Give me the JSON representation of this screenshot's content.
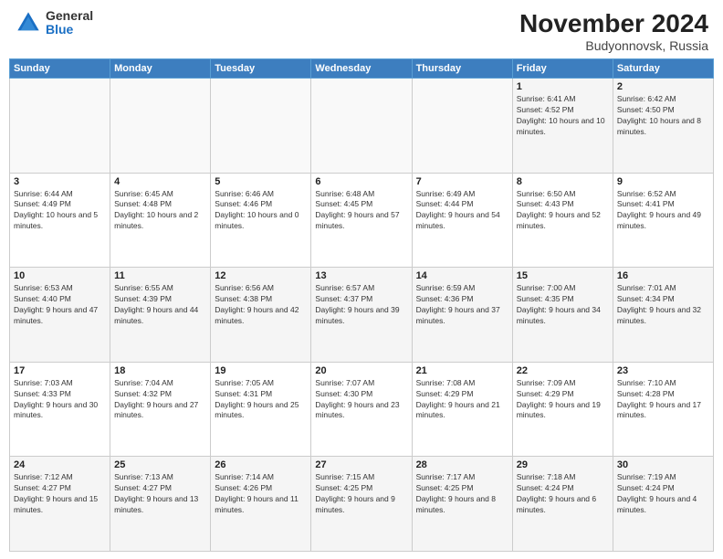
{
  "logo": {
    "general": "General",
    "blue": "Blue"
  },
  "title": "November 2024",
  "location": "Budyonnovsk, Russia",
  "days_of_week": [
    "Sunday",
    "Monday",
    "Tuesday",
    "Wednesday",
    "Thursday",
    "Friday",
    "Saturday"
  ],
  "weeks": [
    [
      {
        "day": "",
        "info": ""
      },
      {
        "day": "",
        "info": ""
      },
      {
        "day": "",
        "info": ""
      },
      {
        "day": "",
        "info": ""
      },
      {
        "day": "",
        "info": ""
      },
      {
        "day": "1",
        "info": "Sunrise: 6:41 AM\nSunset: 4:52 PM\nDaylight: 10 hours and 10 minutes."
      },
      {
        "day": "2",
        "info": "Sunrise: 6:42 AM\nSunset: 4:50 PM\nDaylight: 10 hours and 8 minutes."
      }
    ],
    [
      {
        "day": "3",
        "info": "Sunrise: 6:44 AM\nSunset: 4:49 PM\nDaylight: 10 hours and 5 minutes."
      },
      {
        "day": "4",
        "info": "Sunrise: 6:45 AM\nSunset: 4:48 PM\nDaylight: 10 hours and 2 minutes."
      },
      {
        "day": "5",
        "info": "Sunrise: 6:46 AM\nSunset: 4:46 PM\nDaylight: 10 hours and 0 minutes."
      },
      {
        "day": "6",
        "info": "Sunrise: 6:48 AM\nSunset: 4:45 PM\nDaylight: 9 hours and 57 minutes."
      },
      {
        "day": "7",
        "info": "Sunrise: 6:49 AM\nSunset: 4:44 PM\nDaylight: 9 hours and 54 minutes."
      },
      {
        "day": "8",
        "info": "Sunrise: 6:50 AM\nSunset: 4:43 PM\nDaylight: 9 hours and 52 minutes."
      },
      {
        "day": "9",
        "info": "Sunrise: 6:52 AM\nSunset: 4:41 PM\nDaylight: 9 hours and 49 minutes."
      }
    ],
    [
      {
        "day": "10",
        "info": "Sunrise: 6:53 AM\nSunset: 4:40 PM\nDaylight: 9 hours and 47 minutes."
      },
      {
        "day": "11",
        "info": "Sunrise: 6:55 AM\nSunset: 4:39 PM\nDaylight: 9 hours and 44 minutes."
      },
      {
        "day": "12",
        "info": "Sunrise: 6:56 AM\nSunset: 4:38 PM\nDaylight: 9 hours and 42 minutes."
      },
      {
        "day": "13",
        "info": "Sunrise: 6:57 AM\nSunset: 4:37 PM\nDaylight: 9 hours and 39 minutes."
      },
      {
        "day": "14",
        "info": "Sunrise: 6:59 AM\nSunset: 4:36 PM\nDaylight: 9 hours and 37 minutes."
      },
      {
        "day": "15",
        "info": "Sunrise: 7:00 AM\nSunset: 4:35 PM\nDaylight: 9 hours and 34 minutes."
      },
      {
        "day": "16",
        "info": "Sunrise: 7:01 AM\nSunset: 4:34 PM\nDaylight: 9 hours and 32 minutes."
      }
    ],
    [
      {
        "day": "17",
        "info": "Sunrise: 7:03 AM\nSunset: 4:33 PM\nDaylight: 9 hours and 30 minutes."
      },
      {
        "day": "18",
        "info": "Sunrise: 7:04 AM\nSunset: 4:32 PM\nDaylight: 9 hours and 27 minutes."
      },
      {
        "day": "19",
        "info": "Sunrise: 7:05 AM\nSunset: 4:31 PM\nDaylight: 9 hours and 25 minutes."
      },
      {
        "day": "20",
        "info": "Sunrise: 7:07 AM\nSunset: 4:30 PM\nDaylight: 9 hours and 23 minutes."
      },
      {
        "day": "21",
        "info": "Sunrise: 7:08 AM\nSunset: 4:29 PM\nDaylight: 9 hours and 21 minutes."
      },
      {
        "day": "22",
        "info": "Sunrise: 7:09 AM\nSunset: 4:29 PM\nDaylight: 9 hours and 19 minutes."
      },
      {
        "day": "23",
        "info": "Sunrise: 7:10 AM\nSunset: 4:28 PM\nDaylight: 9 hours and 17 minutes."
      }
    ],
    [
      {
        "day": "24",
        "info": "Sunrise: 7:12 AM\nSunset: 4:27 PM\nDaylight: 9 hours and 15 minutes."
      },
      {
        "day": "25",
        "info": "Sunrise: 7:13 AM\nSunset: 4:27 PM\nDaylight: 9 hours and 13 minutes."
      },
      {
        "day": "26",
        "info": "Sunrise: 7:14 AM\nSunset: 4:26 PM\nDaylight: 9 hours and 11 minutes."
      },
      {
        "day": "27",
        "info": "Sunrise: 7:15 AM\nSunset: 4:25 PM\nDaylight: 9 hours and 9 minutes."
      },
      {
        "day": "28",
        "info": "Sunrise: 7:17 AM\nSunset: 4:25 PM\nDaylight: 9 hours and 8 minutes."
      },
      {
        "day": "29",
        "info": "Sunrise: 7:18 AM\nSunset: 4:24 PM\nDaylight: 9 hours and 6 minutes."
      },
      {
        "day": "30",
        "info": "Sunrise: 7:19 AM\nSunset: 4:24 PM\nDaylight: 9 hours and 4 minutes."
      }
    ]
  ]
}
